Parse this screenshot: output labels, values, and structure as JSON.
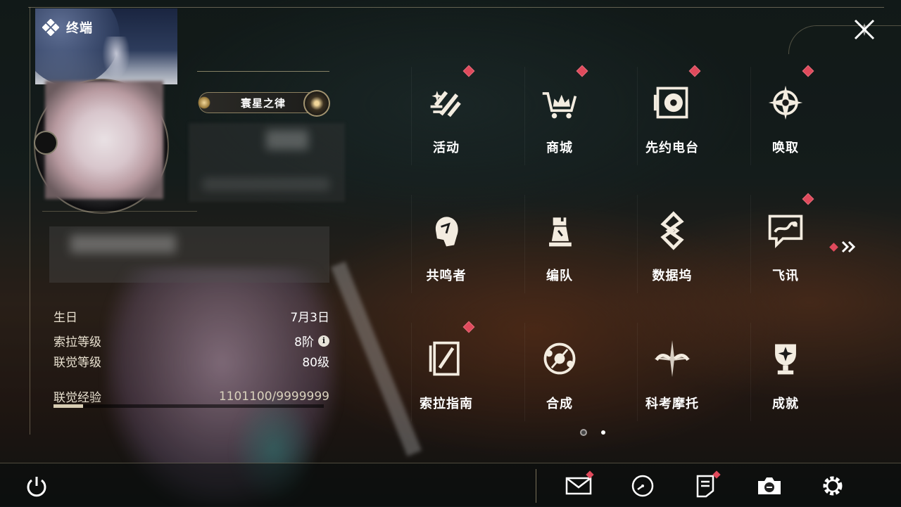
{
  "header": {
    "title": "终端"
  },
  "profile": {
    "badge_name": "寰星之律",
    "stats": [
      {
        "key": "生日",
        "value": "7月3日"
      },
      {
        "key": "索拉等级",
        "value": "8阶"
      },
      {
        "key": "联觉等级",
        "value": "80级"
      }
    ],
    "exp": {
      "key": "联觉经验",
      "value": "1101100/9999999",
      "fraction": 0.11
    }
  },
  "menu": [
    {
      "label": "活动",
      "icon": "event-icon",
      "badge": true
    },
    {
      "label": "商城",
      "icon": "shop-cart-icon",
      "badge": true
    },
    {
      "label": "先约电台",
      "icon": "radio-icon",
      "badge": true
    },
    {
      "label": "唤取",
      "icon": "summon-compass-icon",
      "badge": true
    },
    {
      "label": "共鸣者",
      "icon": "resonator-portrait-icon",
      "badge": false
    },
    {
      "label": "编队",
      "icon": "chess-team-icon",
      "badge": false
    },
    {
      "label": "数据坞",
      "icon": "data-dock-icon",
      "badge": false
    },
    {
      "label": "飞讯",
      "icon": "message-icon",
      "badge": true
    },
    {
      "label": "索拉指南",
      "icon": "guide-book-icon",
      "badge": true
    },
    {
      "label": "合成",
      "icon": "synthesis-icon",
      "badge": false
    },
    {
      "label": "科考摩托",
      "icon": "motorcycle-icon",
      "badge": false
    },
    {
      "label": "成就",
      "icon": "trophy-icon",
      "badge": false
    }
  ],
  "pager": {
    "current": 1,
    "total": 2
  },
  "colors": {
    "accent": "#d8cdb3",
    "badge": "#e04a5c",
    "text": "#f2efe7"
  },
  "bottom_icons": [
    "power-icon",
    "mail-icon",
    "clock-icon",
    "notice-icon",
    "camera-icon",
    "settings-gear-icon"
  ]
}
